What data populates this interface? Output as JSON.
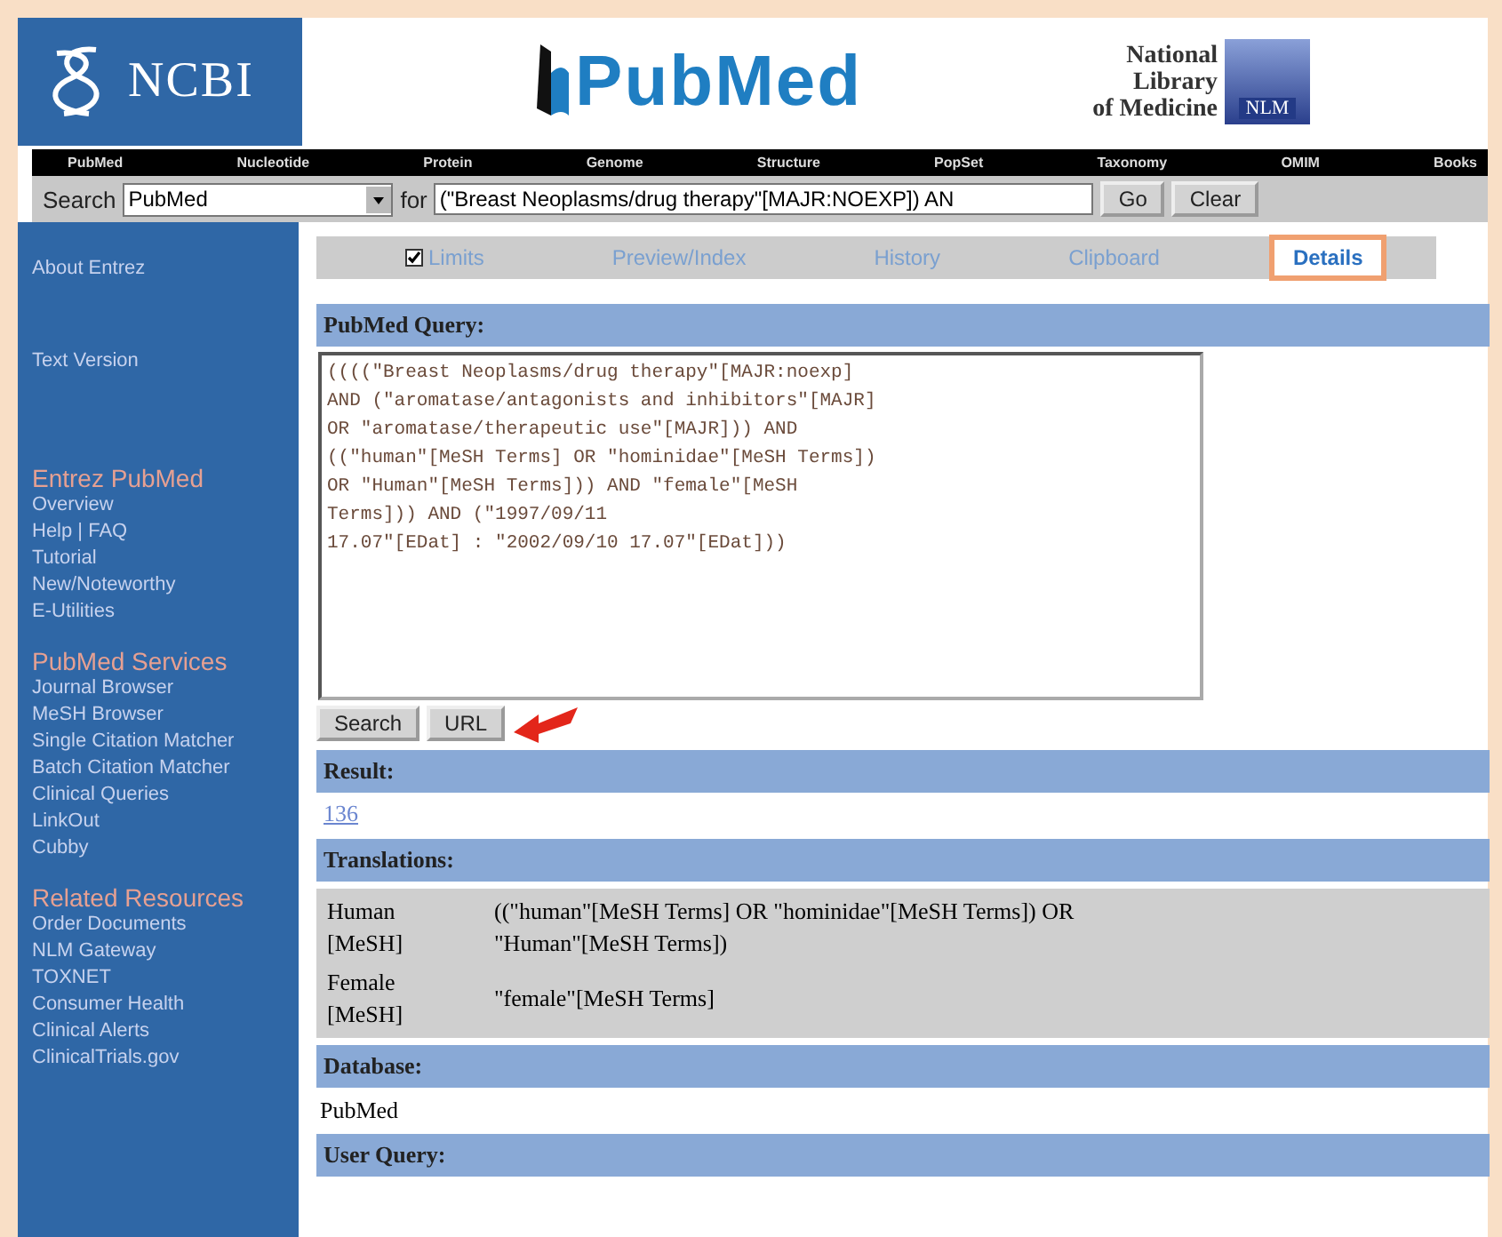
{
  "header": {
    "brand": "NCBI",
    "logo": "PubMed",
    "library_lines": [
      "National",
      "Library",
      "of Medicine"
    ],
    "library_badge": "NLM"
  },
  "nav": [
    "PubMed",
    "Nucleotide",
    "Protein",
    "Genome",
    "Structure",
    "PopSet",
    "Taxonomy",
    "OMIM",
    "Books"
  ],
  "search": {
    "label": "Search",
    "database": "PubMed",
    "for_label": "for",
    "query": "(\"Breast Neoplasms/drug therapy\"[MAJR:NOEXP]) AN",
    "buttons": [
      "Go",
      "Clear"
    ]
  },
  "sidebar": [
    {
      "kind": "link",
      "label": "About Entrez"
    },
    {
      "kind": "link",
      "label": "Text Version"
    },
    {
      "kind": "group",
      "label": "Entrez PubMed",
      "items": [
        "Overview",
        "Help | FAQ",
        "Tutorial",
        "New/Noteworthy",
        "E-Utilities"
      ]
    },
    {
      "kind": "group",
      "label": "PubMed Services",
      "items": [
        "Journal Browser",
        "MeSH Browser",
        "Single Citation Matcher",
        "Batch Citation Matcher",
        "Clinical Queries",
        "LinkOut",
        "Cubby"
      ]
    },
    {
      "kind": "group",
      "label": "Related Resources",
      "items": [
        "Order Documents",
        "NLM Gateway",
        "TOXNET",
        "Consumer Health",
        "Clinical Alerts",
        "ClinicalTrials.gov"
      ]
    }
  ],
  "tabs": [
    {
      "kind": "checkbox",
      "label": "Limits",
      "checked": true,
      "selected": false
    },
    {
      "kind": "plain",
      "label": "Preview/Index",
      "selected": false
    },
    {
      "kind": "plain",
      "label": "History",
      "selected": false
    },
    {
      "kind": "plain",
      "label": "Clipboard",
      "selected": false
    },
    {
      "kind": "plain",
      "label": "Details",
      "selected": true
    }
  ],
  "query_section": {
    "heading": "PubMed Query:",
    "query": "((((\"Breast Neoplasms/drug therapy\"[MAJR:noexp]\nAND (\"aromatase/antagonists and inhibitors\"[MAJR]\nOR \"aromatase/therapeutic use\"[MAJR])) AND\n((\"human\"[MeSH Terms] OR \"hominidae\"[MeSH Terms])\nOR \"Human\"[MeSH Terms])) AND \"female\"[MeSH\nTerms])) AND (\"1997/09/11\n17.07\"[EDat] : \"2002/09/10 17.07\"[EDat]))",
    "buttons": [
      "Search",
      "URL"
    ]
  },
  "result": {
    "heading": "Result:",
    "count": "136"
  },
  "translations": {
    "heading": "Translations:",
    "rows": [
      {
        "term": "Human [MeSH]",
        "translation": "((\"human\"[MeSH Terms] OR \"hominidae\"[MeSH Terms]) OR \"Human\"[MeSH Terms])"
      },
      {
        "term": "Female [MeSH]",
        "translation": "\"female\"[MeSH Terms]"
      }
    ]
  },
  "database": {
    "heading": "Database:",
    "value": "PubMed"
  },
  "user_query": {
    "heading": "User Query:"
  }
}
